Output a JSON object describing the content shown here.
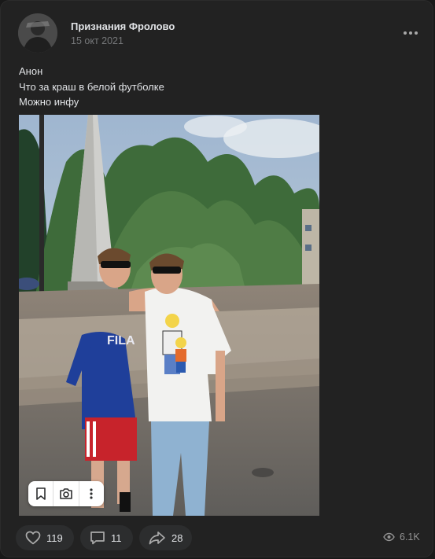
{
  "post": {
    "author": "Признания Фролово",
    "date": "15 окт 2021",
    "text_lines": [
      "Анон",
      "Что за краш в белой футболке",
      "Можно инфу"
    ]
  },
  "photo": {
    "shirt_brand": "FILA"
  },
  "icons": {
    "avatar": "avatar-image",
    "more": "more-dots-icon",
    "bookmark": "bookmark-icon",
    "camera": "camera-icon",
    "photo_more": "vertical-dots-icon",
    "like": "heart-icon",
    "comment": "comment-icon",
    "share": "share-icon",
    "views": "eye-icon"
  },
  "actions": {
    "likes": "119",
    "comments": "11",
    "shares": "28"
  },
  "views": "6.1K",
  "colors": {
    "background": "#191919",
    "card": "#222222",
    "pill": "#2c2d2e",
    "text": "#e1e3e6",
    "muted": "#76787a"
  }
}
